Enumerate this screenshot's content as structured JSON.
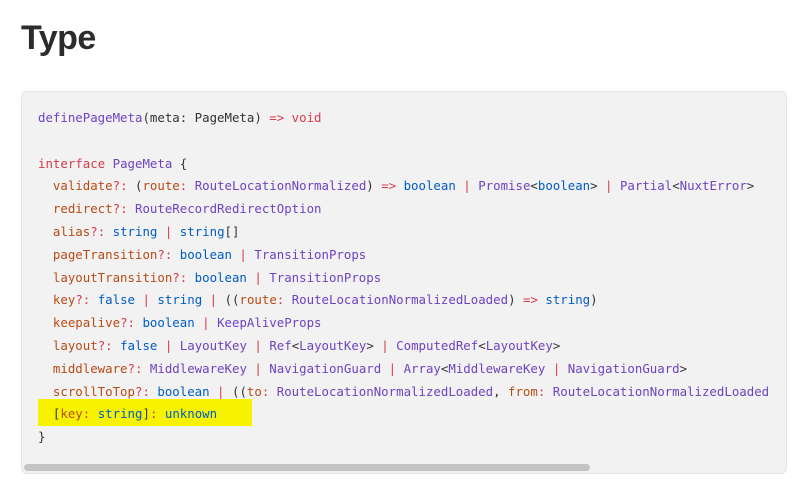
{
  "heading": "Type",
  "code": {
    "lines": [
      [
        {
          "t": "definePageMeta",
          "c": "fn"
        },
        {
          "t": "(",
          "c": "plain"
        },
        {
          "t": "meta",
          "c": "plain"
        },
        {
          "t": ": ",
          "c": "plain"
        },
        {
          "t": "PageMeta",
          "c": "plain"
        },
        {
          "t": ") ",
          "c": "plain"
        },
        {
          "t": "=>",
          "c": "op"
        },
        {
          "t": " ",
          "c": "plain"
        },
        {
          "t": "void",
          "c": "kw"
        }
      ],
      [],
      [
        {
          "t": "interface",
          "c": "kw"
        },
        {
          "t": " ",
          "c": "plain"
        },
        {
          "t": "PageMeta",
          "c": "type"
        },
        {
          "t": " {",
          "c": "plain"
        }
      ],
      [
        {
          "t": "  ",
          "c": "plain"
        },
        {
          "t": "validate",
          "c": "prop"
        },
        {
          "t": "?: ",
          "c": "op"
        },
        {
          "t": "(",
          "c": "plain"
        },
        {
          "t": "route",
          "c": "param"
        },
        {
          "t": ": ",
          "c": "op"
        },
        {
          "t": "RouteLocationNormalized",
          "c": "type"
        },
        {
          "t": ") ",
          "c": "plain"
        },
        {
          "t": "=>",
          "c": "op"
        },
        {
          "t": " ",
          "c": "plain"
        },
        {
          "t": "boolean",
          "c": "bool"
        },
        {
          "t": " | ",
          "c": "op"
        },
        {
          "t": "Promise",
          "c": "type"
        },
        {
          "t": "<",
          "c": "plain"
        },
        {
          "t": "boolean",
          "c": "bool"
        },
        {
          "t": ">",
          "c": "plain"
        },
        {
          "t": " | ",
          "c": "op"
        },
        {
          "t": "Partial",
          "c": "type"
        },
        {
          "t": "<",
          "c": "plain"
        },
        {
          "t": "NuxtError",
          "c": "type"
        },
        {
          "t": ">",
          "c": "plain"
        }
      ],
      [
        {
          "t": "  ",
          "c": "plain"
        },
        {
          "t": "redirect",
          "c": "prop"
        },
        {
          "t": "?: ",
          "c": "op"
        },
        {
          "t": "RouteRecordRedirectOption",
          "c": "type"
        }
      ],
      [
        {
          "t": "  ",
          "c": "plain"
        },
        {
          "t": "alias",
          "c": "prop"
        },
        {
          "t": "?: ",
          "c": "op"
        },
        {
          "t": "string",
          "c": "bool"
        },
        {
          "t": " | ",
          "c": "op"
        },
        {
          "t": "string",
          "c": "bool"
        },
        {
          "t": "[]",
          "c": "plain"
        }
      ],
      [
        {
          "t": "  ",
          "c": "plain"
        },
        {
          "t": "pageTransition",
          "c": "prop"
        },
        {
          "t": "?: ",
          "c": "op"
        },
        {
          "t": "boolean",
          "c": "bool"
        },
        {
          "t": " | ",
          "c": "op"
        },
        {
          "t": "TransitionProps",
          "c": "type"
        }
      ],
      [
        {
          "t": "  ",
          "c": "plain"
        },
        {
          "t": "layoutTransition",
          "c": "prop"
        },
        {
          "t": "?: ",
          "c": "op"
        },
        {
          "t": "boolean",
          "c": "bool"
        },
        {
          "t": " | ",
          "c": "op"
        },
        {
          "t": "TransitionProps",
          "c": "type"
        }
      ],
      [
        {
          "t": "  ",
          "c": "plain"
        },
        {
          "t": "key",
          "c": "prop"
        },
        {
          "t": "?: ",
          "c": "op"
        },
        {
          "t": "false",
          "c": "bool"
        },
        {
          "t": " | ",
          "c": "op"
        },
        {
          "t": "string",
          "c": "bool"
        },
        {
          "t": " | ",
          "c": "op"
        },
        {
          "t": "((",
          "c": "plain"
        },
        {
          "t": "route",
          "c": "param"
        },
        {
          "t": ": ",
          "c": "op"
        },
        {
          "t": "RouteLocationNormalizedLoaded",
          "c": "type"
        },
        {
          "t": ") ",
          "c": "plain"
        },
        {
          "t": "=>",
          "c": "op"
        },
        {
          "t": " ",
          "c": "plain"
        },
        {
          "t": "string",
          "c": "bool"
        },
        {
          "t": ")",
          "c": "plain"
        }
      ],
      [
        {
          "t": "  ",
          "c": "plain"
        },
        {
          "t": "keepalive",
          "c": "prop"
        },
        {
          "t": "?: ",
          "c": "op"
        },
        {
          "t": "boolean",
          "c": "bool"
        },
        {
          "t": " | ",
          "c": "op"
        },
        {
          "t": "KeepAliveProps",
          "c": "type"
        }
      ],
      [
        {
          "t": "  ",
          "c": "plain"
        },
        {
          "t": "layout",
          "c": "prop"
        },
        {
          "t": "?: ",
          "c": "op"
        },
        {
          "t": "false",
          "c": "bool"
        },
        {
          "t": " | ",
          "c": "op"
        },
        {
          "t": "LayoutKey",
          "c": "type"
        },
        {
          "t": " | ",
          "c": "op"
        },
        {
          "t": "Ref",
          "c": "type"
        },
        {
          "t": "<",
          "c": "plain"
        },
        {
          "t": "LayoutKey",
          "c": "type"
        },
        {
          "t": ">",
          "c": "plain"
        },
        {
          "t": " | ",
          "c": "op"
        },
        {
          "t": "ComputedRef",
          "c": "type"
        },
        {
          "t": "<",
          "c": "plain"
        },
        {
          "t": "LayoutKey",
          "c": "type"
        },
        {
          "t": ">",
          "c": "plain"
        }
      ],
      [
        {
          "t": "  ",
          "c": "plain"
        },
        {
          "t": "middleware",
          "c": "prop"
        },
        {
          "t": "?: ",
          "c": "op"
        },
        {
          "t": "MiddlewareKey",
          "c": "type"
        },
        {
          "t": " | ",
          "c": "op"
        },
        {
          "t": "NavigationGuard",
          "c": "type"
        },
        {
          "t": " | ",
          "c": "op"
        },
        {
          "t": "Array",
          "c": "type"
        },
        {
          "t": "<",
          "c": "plain"
        },
        {
          "t": "MiddlewareKey",
          "c": "type"
        },
        {
          "t": " | ",
          "c": "op"
        },
        {
          "t": "NavigationGuard",
          "c": "type"
        },
        {
          "t": ">",
          "c": "plain"
        }
      ],
      [
        {
          "t": "  ",
          "c": "plain"
        },
        {
          "t": "scrollToTop",
          "c": "prop"
        },
        {
          "t": "?: ",
          "c": "op"
        },
        {
          "t": "boolean",
          "c": "bool"
        },
        {
          "t": " | ",
          "c": "op"
        },
        {
          "t": "((",
          "c": "plain"
        },
        {
          "t": "to",
          "c": "param"
        },
        {
          "t": ": ",
          "c": "op"
        },
        {
          "t": "RouteLocationNormalizedLoaded",
          "c": "type"
        },
        {
          "t": ", ",
          "c": "plain"
        },
        {
          "t": "from",
          "c": "param"
        },
        {
          "t": ": ",
          "c": "op"
        },
        {
          "t": "RouteLocationNormalizedLoaded",
          "c": "type"
        }
      ],
      [
        {
          "t": "  ",
          "c": "plain"
        },
        {
          "t": "[",
          "c": "plain"
        },
        {
          "t": "key",
          "c": "prop"
        },
        {
          "t": ": ",
          "c": "op"
        },
        {
          "t": "string",
          "c": "bool"
        },
        {
          "t": "]",
          "c": "plain"
        },
        {
          "t": ": ",
          "c": "op"
        },
        {
          "t": "unknown",
          "c": "bool"
        }
      ],
      [
        {
          "t": "}",
          "c": "plain"
        }
      ]
    ]
  },
  "colors": {
    "highlight": "#f7f300",
    "code_background": "#f2f2f2"
  }
}
